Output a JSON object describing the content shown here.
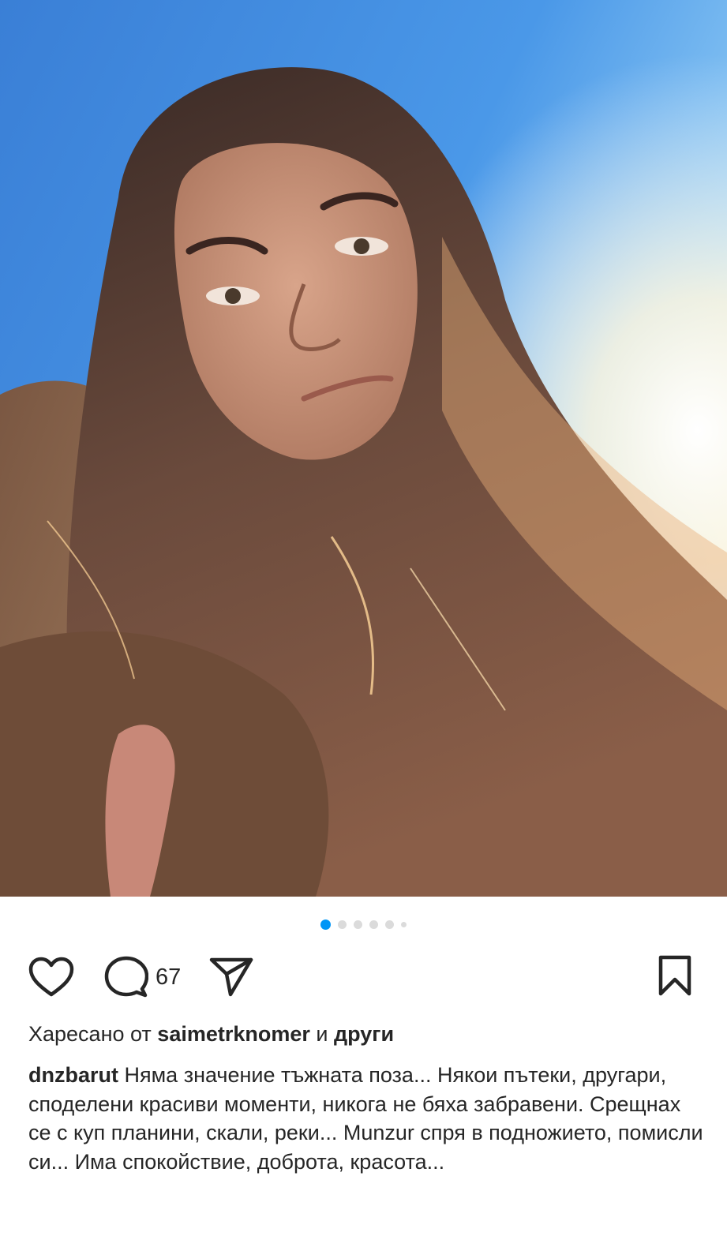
{
  "post": {
    "photo_alt": "selfie",
    "carousel": {
      "count": 6,
      "active_index": 0
    },
    "actions": {
      "like_icon": "heart-outline-icon",
      "comment_icon": "comment-bubble-icon",
      "comment_count": "67",
      "share_icon": "paper-plane-icon",
      "save_icon": "bookmark-outline-icon"
    },
    "likes": {
      "prefix": "Харесано от ",
      "user": "saimetrknomer",
      "conjunction": " и ",
      "others": "други"
    },
    "caption": {
      "username": "dnzbarut",
      "text": " Няма значение тъжната поза... Някои пътеки, другари, споделени красиви моменти, никога не бяха забравени. Срещнах се с куп планини, скали, реки... Munzur спря в подножието, помисли си... Има спокойствие, доброта, красота..."
    },
    "colors": {
      "accent": "#0095f6",
      "text": "#262626",
      "dot_inactive": "#dbdbdb"
    }
  }
}
